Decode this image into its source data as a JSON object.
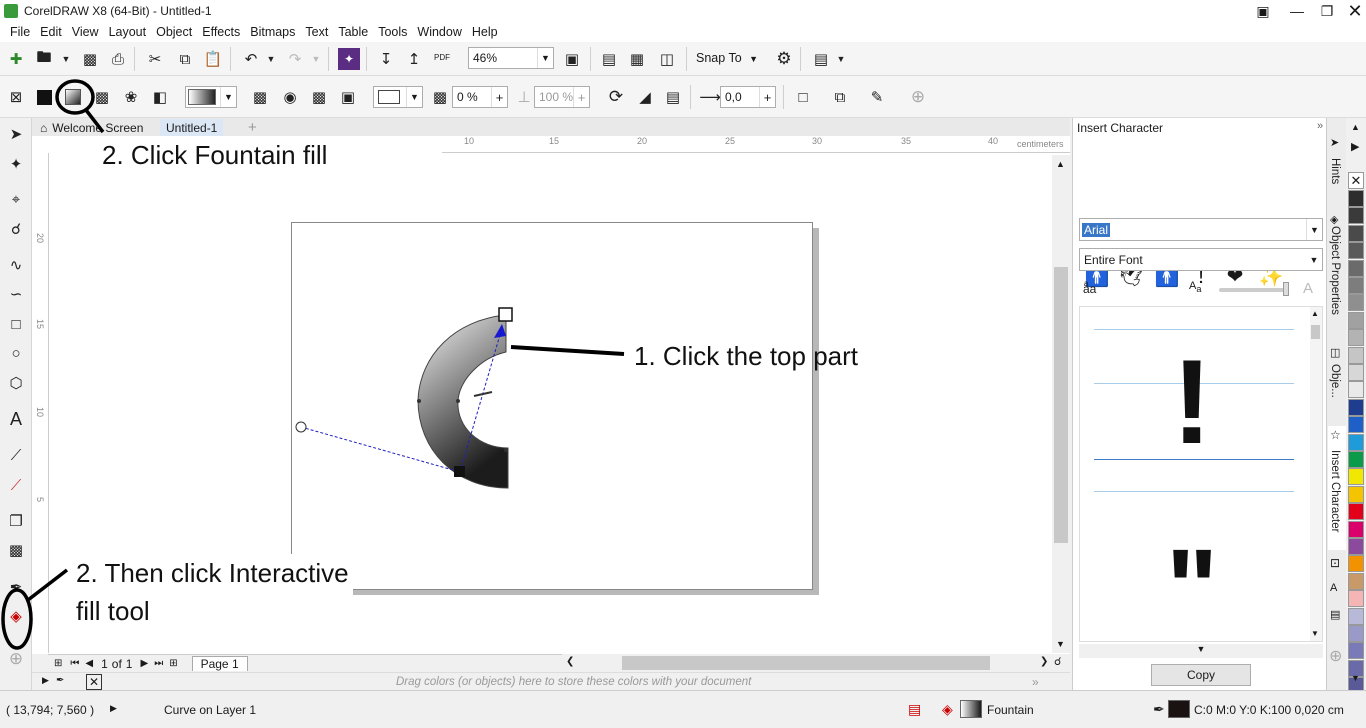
{
  "window": {
    "title": "CorelDRAW X8 (64-Bit) - Untitled-1"
  },
  "menu": [
    "File",
    "Edit",
    "View",
    "Layout",
    "Object",
    "Effects",
    "Bitmaps",
    "Text",
    "Table",
    "Tools",
    "Window",
    "Help"
  ],
  "standard_toolbar": {
    "zoom_value": "46%",
    "snap_to_label": "Snap To",
    "pdf_label": "PDF"
  },
  "property_bar": {
    "transparency_value": "0 %",
    "opacity_value": "100 %",
    "offset_value": "0,0"
  },
  "doc_tabs": {
    "welcome": "Welcome Screen",
    "active": "Untitled-1"
  },
  "ruler": {
    "h_ticks": [
      "10",
      "15",
      "20",
      "25",
      "30",
      "35",
      "40"
    ],
    "v_ticks": [
      "20",
      "15",
      "10",
      "5"
    ],
    "units": "centimeters"
  },
  "annotations": {
    "fountain": "2. Click Fountain fill",
    "top_part": "1. Click the top part",
    "interactive_line1": "2. Then click Interactive",
    "interactive_line2": "fill tool"
  },
  "page_nav": {
    "current": "1",
    "of_label": "of",
    "total": "1",
    "page_tab": "Page 1"
  },
  "doc_palette_hint": "Drag colors (or objects) here to store these colors with your document",
  "docker": {
    "title": "Insert Character",
    "font_value": "Arial",
    "filter_value": "Entire Font",
    "copy_label": "Copy",
    "preview_chars": [
      "!",
      "\""
    ]
  },
  "docker_tabs": [
    "Hints",
    "Object Properties",
    "Obje...",
    "Insert Character"
  ],
  "status": {
    "coords": "( 13,794; 7,560 )",
    "object_info": "Curve on Layer 1",
    "fill_label": "Fountain",
    "outline_info": "C:0 M:0 Y:0 K:100  0,020 cm"
  },
  "palette_colors": [
    "#2d2d2d",
    "#3a3a3a",
    "#4a4a4a",
    "#5a5a5a",
    "#6b6b6b",
    "#7d7d7d",
    "#8f8f8f",
    "#a1a1a1",
    "#b3b3b3",
    "#c5c5c5",
    "#d7d7d7",
    "#e9e9e9",
    "#1f3d8f",
    "#1f5fc8",
    "#1e9bd8",
    "#0a9a4a",
    "#f0e800",
    "#f5c400",
    "#e2001a",
    "#d9006c",
    "#8c4a9c",
    "#f39200",
    "#c89a6a",
    "#f5b5b5",
    "#b8b8d8",
    "#9a9ac8",
    "#7a7ab8",
    "#6a6aa8",
    "#5a5a98"
  ]
}
